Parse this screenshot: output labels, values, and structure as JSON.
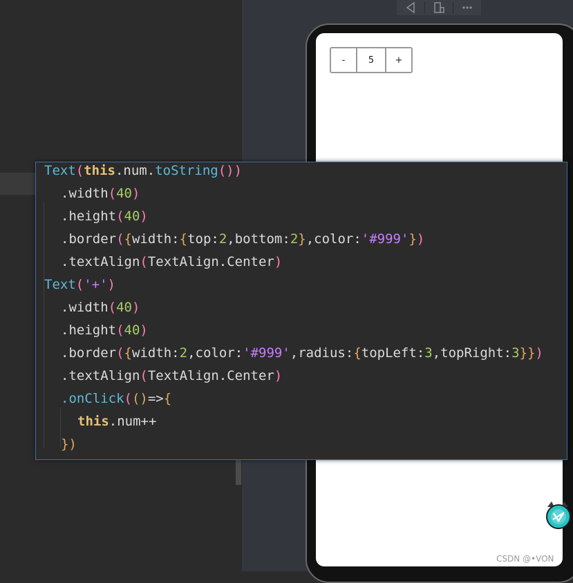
{
  "preview": {
    "toolbar": {
      "icons": [
        "back-triangle-icon",
        "device-layout-icon",
        "more-dots-icon"
      ]
    },
    "counter": {
      "minus_label": "-",
      "value": "5",
      "plus_label": "+"
    },
    "colors": {
      "border": "#999999",
      "screen": "#ffffff"
    }
  },
  "code": {
    "lines": [
      {
        "indent": 0,
        "segments": [
          [
            "fn",
            "Text"
          ],
          [
            "p2",
            "("
          ],
          [
            "kw",
            "this"
          ],
          [
            "id",
            ".num."
          ],
          [
            "fn",
            "toString"
          ],
          [
            "p2",
            "())"
          ]
        ]
      },
      {
        "indent": 1,
        "segments": [
          [
            "prop",
            ".width"
          ],
          [
            "p2",
            "("
          ],
          [
            "num",
            "40"
          ],
          [
            "p2",
            ")"
          ]
        ]
      },
      {
        "indent": 1,
        "segments": [
          [
            "prop",
            ".height"
          ],
          [
            "p2",
            "("
          ],
          [
            "num",
            "40"
          ],
          [
            "p2",
            ")"
          ]
        ]
      },
      {
        "indent": 1,
        "segments": [
          [
            "prop",
            ".border"
          ],
          [
            "p2",
            "("
          ],
          [
            "p1",
            "{"
          ],
          [
            "id",
            "width:"
          ],
          [
            "p1",
            "{"
          ],
          [
            "id",
            "top:"
          ],
          [
            "num",
            "2"
          ],
          [
            "id",
            ",bottom:"
          ],
          [
            "num",
            "2"
          ],
          [
            "p1",
            "}"
          ],
          [
            "id",
            ",color:"
          ],
          [
            "str",
            "'#999'"
          ],
          [
            "p1",
            "}"
          ],
          [
            "p2",
            ")"
          ]
        ]
      },
      {
        "indent": 1,
        "segments": [
          [
            "prop",
            ".textAlign"
          ],
          [
            "p2",
            "("
          ],
          [
            "id",
            "TextAlign.Center"
          ],
          [
            "p2",
            ")"
          ]
        ]
      },
      {
        "indent": 0,
        "segments": [
          [
            "fn",
            "Text"
          ],
          [
            "p2",
            "("
          ],
          [
            "str",
            "'+'"
          ],
          [
            "p2",
            ")"
          ]
        ]
      },
      {
        "indent": 1,
        "segments": [
          [
            "prop",
            ".width"
          ],
          [
            "p2",
            "("
          ],
          [
            "num",
            "40"
          ],
          [
            "p2",
            ")"
          ]
        ]
      },
      {
        "indent": 1,
        "segments": [
          [
            "prop",
            ".height"
          ],
          [
            "p2",
            "("
          ],
          [
            "num",
            "40"
          ],
          [
            "p2",
            ")"
          ]
        ]
      },
      {
        "indent": 1,
        "segments": [
          [
            "prop",
            ".border"
          ],
          [
            "p2",
            "("
          ],
          [
            "p1",
            "{"
          ],
          [
            "id",
            "width:"
          ],
          [
            "num",
            "2"
          ],
          [
            "id",
            ",color:"
          ],
          [
            "str",
            "'#999'"
          ],
          [
            "id",
            ",radius:"
          ],
          [
            "p1",
            "{"
          ],
          [
            "id",
            "topLeft:"
          ],
          [
            "num",
            "3"
          ],
          [
            "id",
            ",topRight:"
          ],
          [
            "num",
            "3"
          ],
          [
            "p1",
            "}}"
          ],
          [
            "p2",
            ")"
          ]
        ]
      },
      {
        "indent": 1,
        "segments": [
          [
            "prop",
            ".textAlign"
          ],
          [
            "p2",
            "("
          ],
          [
            "id",
            "TextAlign.Center"
          ],
          [
            "p2",
            ")"
          ]
        ]
      },
      {
        "indent": 1,
        "segments": [
          [
            "fn",
            ".onClick"
          ],
          [
            "p2",
            "("
          ],
          [
            "p1",
            "()"
          ],
          [
            "id",
            "=>"
          ],
          [
            "p1",
            "{"
          ]
        ]
      },
      {
        "indent": 2,
        "segments": [
          [
            "kw",
            "this"
          ],
          [
            "id",
            ".num++"
          ]
        ]
      },
      {
        "indent": 1,
        "segments": [
          [
            "p1",
            "})"
          ]
        ]
      }
    ]
  },
  "watermark": {
    "text": "CSDN @•VON"
  },
  "mascot_icon": "cat-mascot-icon"
}
